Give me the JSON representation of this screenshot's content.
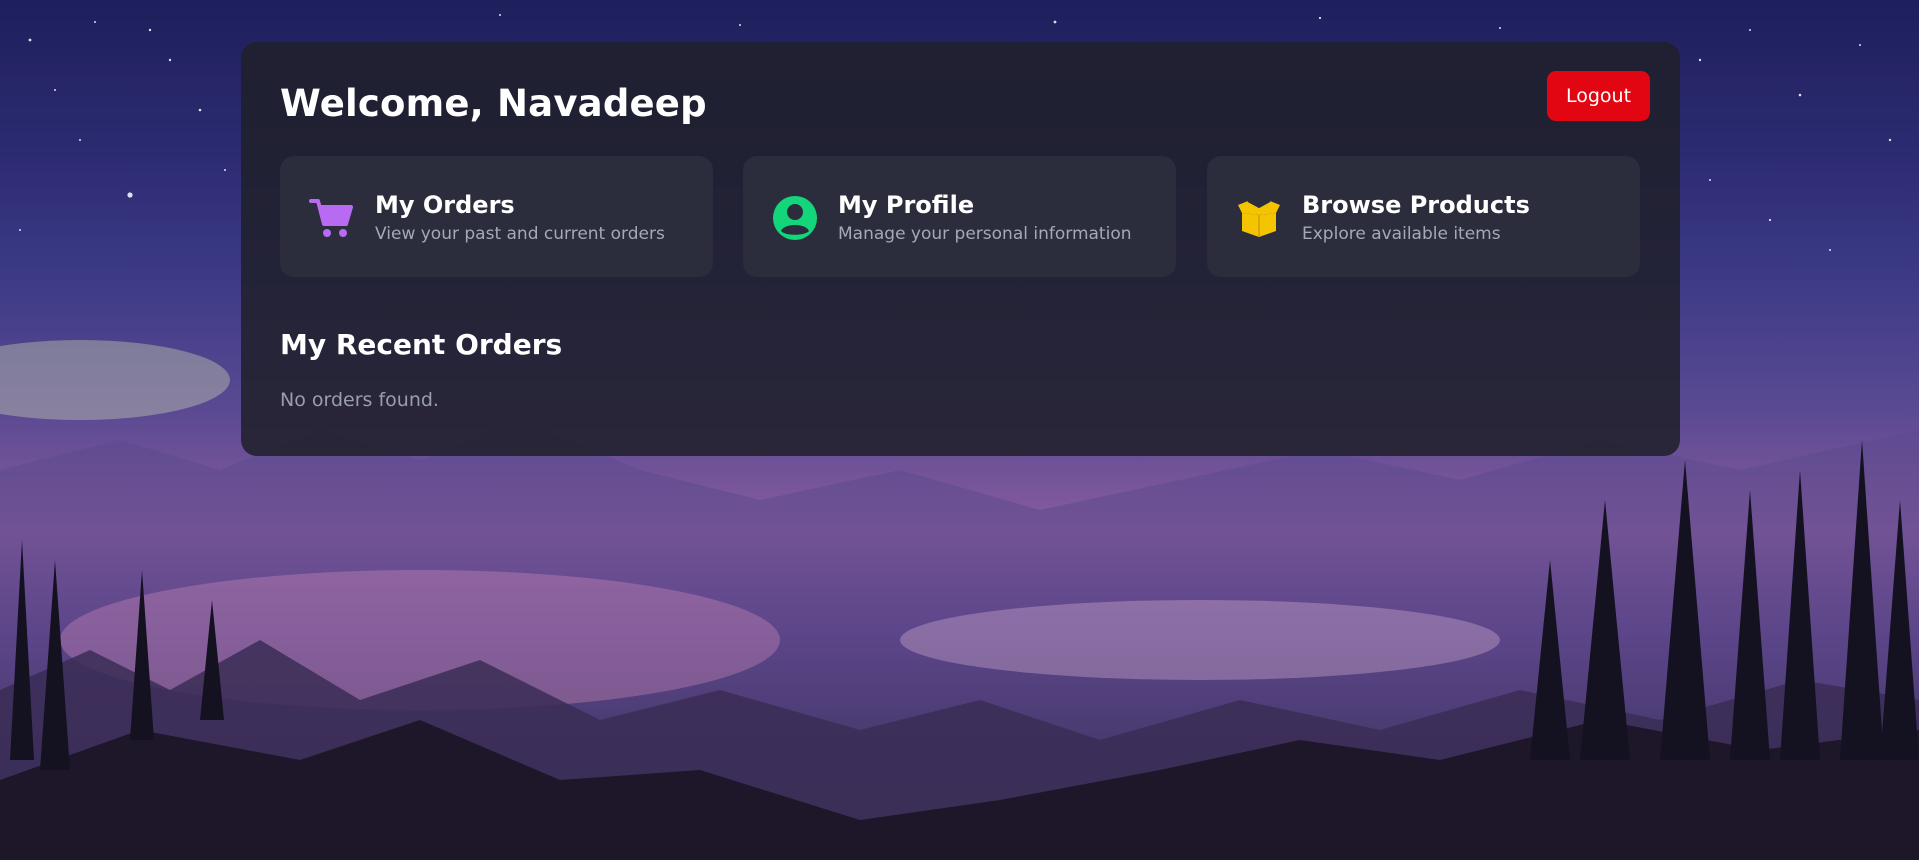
{
  "header": {
    "welcome_text": "Welcome, Navadeep",
    "logout_label": "Logout"
  },
  "cards": [
    {
      "title": "My Orders",
      "description": "View your past and current orders",
      "icon": "shopping-cart-icon",
      "icon_color": "#b86bf2"
    },
    {
      "title": "My Profile",
      "description": "Manage your personal information",
      "icon": "user-circle-icon",
      "icon_color": "#13d67a"
    },
    {
      "title": "Browse Products",
      "description": "Explore available items",
      "icon": "open-box-icon",
      "icon_color": "#f5c400"
    }
  ],
  "recent_orders": {
    "heading": "My Recent Orders",
    "empty_message": "No orders found."
  },
  "colors": {
    "logout_button": "#e20613",
    "panel_background": "#1f1f2a",
    "card_background": "#2b2c3c"
  }
}
